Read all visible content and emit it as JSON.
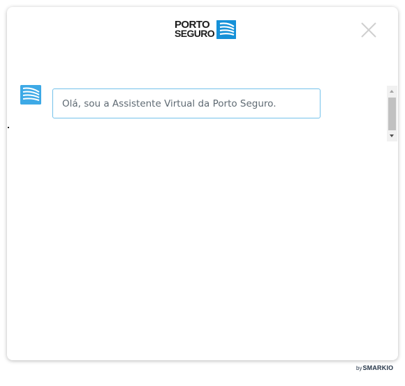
{
  "header": {
    "logo_line1": "PORTO",
    "logo_line2": "SEGURO",
    "logo_icon": "porto-seguro-sails-icon",
    "close_icon": "close-icon"
  },
  "chat": {
    "avatar_icon": "porto-seguro-sails-icon",
    "messages": [
      {
        "sender": "bot",
        "text": "Olá, sou a Assistente Virtual da Porto Seguro."
      }
    ]
  },
  "footer": {
    "by_label": "by",
    "brand": "SMARKIO"
  },
  "colors": {
    "brand_blue": "#1591d8",
    "avatar_blue": "#3da9e6",
    "bubble_border": "#73c1eb",
    "message_text": "#5f6a73"
  }
}
